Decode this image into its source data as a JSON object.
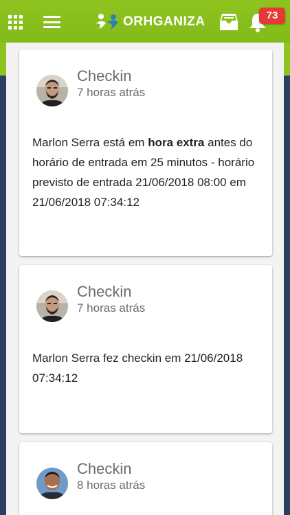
{
  "header": {
    "logo_text": "ORHGANIZA",
    "notification_count": "73",
    "icons": [
      "apps-grid-icon",
      "hamburger-menu-icon",
      "inbox-icon",
      "bell-icon"
    ],
    "colors": {
      "header_green": "#8fc320",
      "badge_red": "#e53935",
      "navy": "#2d3f5f"
    }
  },
  "feed": {
    "cards": [
      {
        "title": "Checkin",
        "time": "7 horas atrás",
        "body_pre": "Marlon Serra está em ",
        "body_bold": "hora extra",
        "body_post": " antes do horário de entrada em 25 minutos - horário previsto de entrada 21/06/2018 08:00 em 21/06/2018 07:34:12"
      },
      {
        "title": "Checkin",
        "time": "7 horas atrás",
        "body": "Marlon Serra fez checkin em 21/06/2018 07:34:12"
      },
      {
        "title": "Checkin",
        "time": "8 horas atrás"
      }
    ]
  }
}
